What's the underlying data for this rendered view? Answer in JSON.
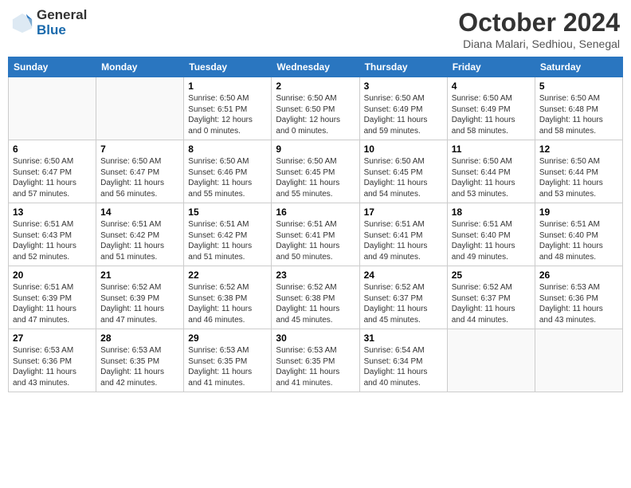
{
  "logo": {
    "general": "General",
    "blue": "Blue"
  },
  "title": "October 2024",
  "subtitle": "Diana Malari, Sedhiou, Senegal",
  "headers": [
    "Sunday",
    "Monday",
    "Tuesday",
    "Wednesday",
    "Thursday",
    "Friday",
    "Saturday"
  ],
  "weeks": [
    [
      {
        "day": "",
        "sunrise": "",
        "sunset": "",
        "daylight": ""
      },
      {
        "day": "",
        "sunrise": "",
        "sunset": "",
        "daylight": ""
      },
      {
        "day": "1",
        "sunrise": "Sunrise: 6:50 AM",
        "sunset": "Sunset: 6:51 PM",
        "daylight": "Daylight: 12 hours and 0 minutes."
      },
      {
        "day": "2",
        "sunrise": "Sunrise: 6:50 AM",
        "sunset": "Sunset: 6:50 PM",
        "daylight": "Daylight: 12 hours and 0 minutes."
      },
      {
        "day": "3",
        "sunrise": "Sunrise: 6:50 AM",
        "sunset": "Sunset: 6:49 PM",
        "daylight": "Daylight: 11 hours and 59 minutes."
      },
      {
        "day": "4",
        "sunrise": "Sunrise: 6:50 AM",
        "sunset": "Sunset: 6:49 PM",
        "daylight": "Daylight: 11 hours and 58 minutes."
      },
      {
        "day": "5",
        "sunrise": "Sunrise: 6:50 AM",
        "sunset": "Sunset: 6:48 PM",
        "daylight": "Daylight: 11 hours and 58 minutes."
      }
    ],
    [
      {
        "day": "6",
        "sunrise": "Sunrise: 6:50 AM",
        "sunset": "Sunset: 6:47 PM",
        "daylight": "Daylight: 11 hours and 57 minutes."
      },
      {
        "day": "7",
        "sunrise": "Sunrise: 6:50 AM",
        "sunset": "Sunset: 6:47 PM",
        "daylight": "Daylight: 11 hours and 56 minutes."
      },
      {
        "day": "8",
        "sunrise": "Sunrise: 6:50 AM",
        "sunset": "Sunset: 6:46 PM",
        "daylight": "Daylight: 11 hours and 55 minutes."
      },
      {
        "day": "9",
        "sunrise": "Sunrise: 6:50 AM",
        "sunset": "Sunset: 6:45 PM",
        "daylight": "Daylight: 11 hours and 55 minutes."
      },
      {
        "day": "10",
        "sunrise": "Sunrise: 6:50 AM",
        "sunset": "Sunset: 6:45 PM",
        "daylight": "Daylight: 11 hours and 54 minutes."
      },
      {
        "day": "11",
        "sunrise": "Sunrise: 6:50 AM",
        "sunset": "Sunset: 6:44 PM",
        "daylight": "Daylight: 11 hours and 53 minutes."
      },
      {
        "day": "12",
        "sunrise": "Sunrise: 6:50 AM",
        "sunset": "Sunset: 6:44 PM",
        "daylight": "Daylight: 11 hours and 53 minutes."
      }
    ],
    [
      {
        "day": "13",
        "sunrise": "Sunrise: 6:51 AM",
        "sunset": "Sunset: 6:43 PM",
        "daylight": "Daylight: 11 hours and 52 minutes."
      },
      {
        "day": "14",
        "sunrise": "Sunrise: 6:51 AM",
        "sunset": "Sunset: 6:42 PM",
        "daylight": "Daylight: 11 hours and 51 minutes."
      },
      {
        "day": "15",
        "sunrise": "Sunrise: 6:51 AM",
        "sunset": "Sunset: 6:42 PM",
        "daylight": "Daylight: 11 hours and 51 minutes."
      },
      {
        "day": "16",
        "sunrise": "Sunrise: 6:51 AM",
        "sunset": "Sunset: 6:41 PM",
        "daylight": "Daylight: 11 hours and 50 minutes."
      },
      {
        "day": "17",
        "sunrise": "Sunrise: 6:51 AM",
        "sunset": "Sunset: 6:41 PM",
        "daylight": "Daylight: 11 hours and 49 minutes."
      },
      {
        "day": "18",
        "sunrise": "Sunrise: 6:51 AM",
        "sunset": "Sunset: 6:40 PM",
        "daylight": "Daylight: 11 hours and 49 minutes."
      },
      {
        "day": "19",
        "sunrise": "Sunrise: 6:51 AM",
        "sunset": "Sunset: 6:40 PM",
        "daylight": "Daylight: 11 hours and 48 minutes."
      }
    ],
    [
      {
        "day": "20",
        "sunrise": "Sunrise: 6:51 AM",
        "sunset": "Sunset: 6:39 PM",
        "daylight": "Daylight: 11 hours and 47 minutes."
      },
      {
        "day": "21",
        "sunrise": "Sunrise: 6:52 AM",
        "sunset": "Sunset: 6:39 PM",
        "daylight": "Daylight: 11 hours and 47 minutes."
      },
      {
        "day": "22",
        "sunrise": "Sunrise: 6:52 AM",
        "sunset": "Sunset: 6:38 PM",
        "daylight": "Daylight: 11 hours and 46 minutes."
      },
      {
        "day": "23",
        "sunrise": "Sunrise: 6:52 AM",
        "sunset": "Sunset: 6:38 PM",
        "daylight": "Daylight: 11 hours and 45 minutes."
      },
      {
        "day": "24",
        "sunrise": "Sunrise: 6:52 AM",
        "sunset": "Sunset: 6:37 PM",
        "daylight": "Daylight: 11 hours and 45 minutes."
      },
      {
        "day": "25",
        "sunrise": "Sunrise: 6:52 AM",
        "sunset": "Sunset: 6:37 PM",
        "daylight": "Daylight: 11 hours and 44 minutes."
      },
      {
        "day": "26",
        "sunrise": "Sunrise: 6:53 AM",
        "sunset": "Sunset: 6:36 PM",
        "daylight": "Daylight: 11 hours and 43 minutes."
      }
    ],
    [
      {
        "day": "27",
        "sunrise": "Sunrise: 6:53 AM",
        "sunset": "Sunset: 6:36 PM",
        "daylight": "Daylight: 11 hours and 43 minutes."
      },
      {
        "day": "28",
        "sunrise": "Sunrise: 6:53 AM",
        "sunset": "Sunset: 6:35 PM",
        "daylight": "Daylight: 11 hours and 42 minutes."
      },
      {
        "day": "29",
        "sunrise": "Sunrise: 6:53 AM",
        "sunset": "Sunset: 6:35 PM",
        "daylight": "Daylight: 11 hours and 41 minutes."
      },
      {
        "day": "30",
        "sunrise": "Sunrise: 6:53 AM",
        "sunset": "Sunset: 6:35 PM",
        "daylight": "Daylight: 11 hours and 41 minutes."
      },
      {
        "day": "31",
        "sunrise": "Sunrise: 6:54 AM",
        "sunset": "Sunset: 6:34 PM",
        "daylight": "Daylight: 11 hours and 40 minutes."
      },
      {
        "day": "",
        "sunrise": "",
        "sunset": "",
        "daylight": ""
      },
      {
        "day": "",
        "sunrise": "",
        "sunset": "",
        "daylight": ""
      }
    ]
  ]
}
